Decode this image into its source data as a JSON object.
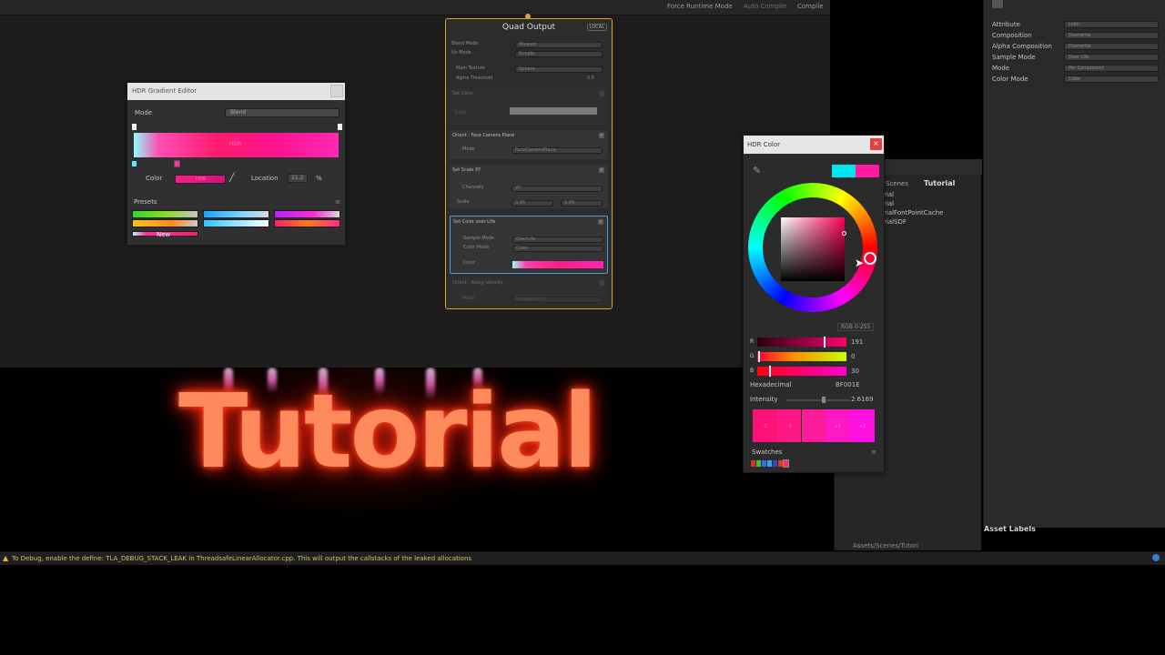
{
  "graph_toolbar": {
    "force_runtime": "Force Runtime Mode",
    "auto_compile": "Auto Compile",
    "compile": "Compile"
  },
  "quad_output": {
    "title": "Quad Output",
    "badge": "LOCAL",
    "settings": [
      {
        "label": "Blend Mode",
        "value": "Masked"
      },
      {
        "label": "Uv Mode",
        "value": "Simple"
      },
      {
        "label": "Main Texture",
        "value": "Sphere"
      },
      {
        "label": "Alpha Threshold",
        "value": "0.5"
      }
    ],
    "blocks": [
      {
        "title": "Set Color",
        "row_label": "Color",
        "value": "",
        "disabled": true
      },
      {
        "title": "Orient : Face Camera Plane",
        "row_label": "Mode",
        "value": "FaceCameraPlane",
        "disabled": false
      },
      {
        "title": "Set Scale XY",
        "row_label": "Channels",
        "row_label2": "Scale",
        "value": "XY",
        "value2": "0.05",
        "value3": "0.05",
        "disabled": false
      },
      {
        "title": "Set Color over Life",
        "row_label": "Sample Mode",
        "row_label2": "Color Mode",
        "row_label3": "Color",
        "value": "OverLife",
        "value2": "Color",
        "disabled": false
      },
      {
        "title": "Orient : Along Velocity",
        "row_label": "Mode",
        "value": "AlongVelocity",
        "disabled": true
      }
    ]
  },
  "gradient_editor": {
    "title": "HDR Gradient Editor",
    "mode_label": "Mode",
    "mode_value": "Blend",
    "color_label": "Color",
    "color_swatch_text": "HDR",
    "location_label": "Location",
    "location_value": "21.2",
    "location_unit": "%",
    "presets_label": "Presets",
    "new_label": "New",
    "bar_text": "HDR"
  },
  "inspector": {
    "rows": [
      {
        "label": "Attribute",
        "value": "color"
      },
      {
        "label": "Composition",
        "value": "Overwrite"
      },
      {
        "label": "Alpha Composition",
        "value": "Overwrite"
      },
      {
        "label": "Sample Mode",
        "value": "Over Life"
      },
      {
        "label": "Mode",
        "value": "Per Component"
      },
      {
        "label": "Color Mode",
        "value": "Color"
      }
    ],
    "asset_labels": "Asset Labels"
  },
  "project": {
    "breadcrumb_scenes": "Scenes",
    "breadcrumb_tutorial": "Tutorial",
    "items": [
      "rial",
      "rial",
      "rialFontPointCache",
      "rialSDF"
    ],
    "path": "Assets/Scenes/Tutori"
  },
  "hdr_picker": {
    "title": "HDR Color",
    "mode": "RGB 0-255",
    "sliders": [
      {
        "letter": "R",
        "value": "191"
      },
      {
        "letter": "G",
        "value": "0"
      },
      {
        "letter": "B",
        "value": "30"
      }
    ],
    "hex_label": "Hexadecimal",
    "hex_value": "BF001E",
    "intensity_label": "Intensity",
    "intensity_value": "2.6169",
    "exposure_labels": [
      "-2",
      "-1",
      "",
      "+1",
      "+2"
    ],
    "swatches_label": "Swatches",
    "colors": {
      "accent": "#ff1a8a",
      "selected": "#BF001E"
    }
  },
  "game_view": {
    "text": "Tutorial"
  },
  "console": {
    "message": "To Debug, enable the define: TLA_DEBUG_STACK_LEAK in ThreadsafeLinearAllocator.cpp. This will output the callstacks of the leaked allocations"
  }
}
